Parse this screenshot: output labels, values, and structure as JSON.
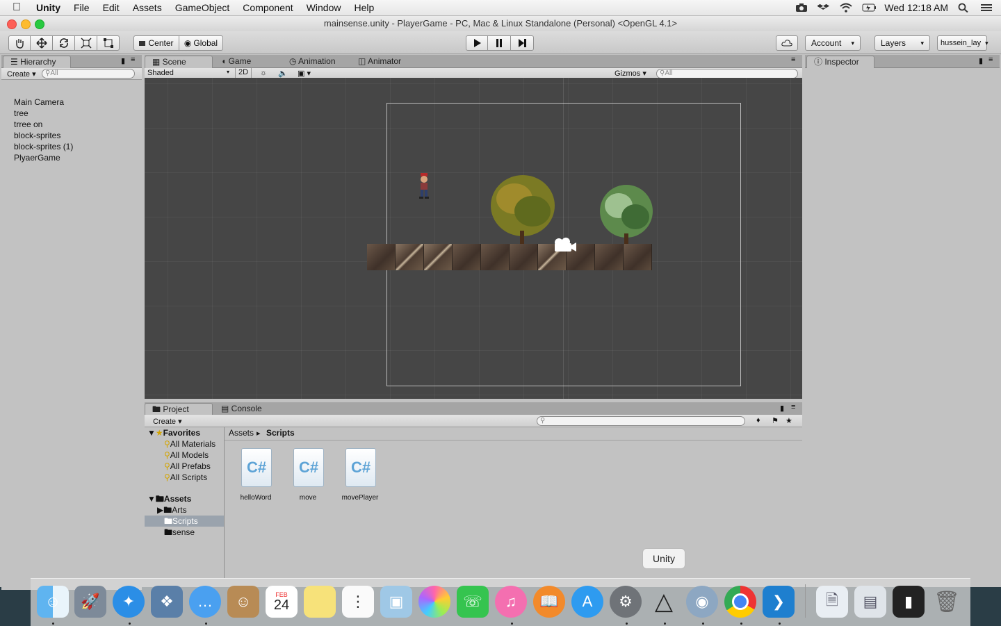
{
  "menubar": {
    "app_name": "Unity",
    "items": [
      "File",
      "Edit",
      "Assets",
      "GameObject",
      "Component",
      "Window",
      "Help"
    ],
    "clock": "Wed 12:18 AM"
  },
  "window": {
    "title": "mainsense.unity - PlayerGame - PC, Mac & Linux Standalone (Personal) <OpenGL 4.1>"
  },
  "toolbar": {
    "pivot": "Center",
    "space": "Global",
    "account": "Account",
    "layers": "Layers",
    "layout": "hussein_lay"
  },
  "hierarchy": {
    "tab": "Hierarchy",
    "create": "Create",
    "search_placeholder": "All",
    "items": [
      "Main Camera",
      "tree",
      "trree on",
      "block-sprites",
      "block-sprites (1)",
      "PlyaerGame"
    ]
  },
  "scene_panel": {
    "tabs": [
      "Scene",
      "Game",
      "Animation",
      "Animator"
    ],
    "shading": "Shaded",
    "mode_2d": "2D",
    "gizmos": "Gizmos",
    "search_placeholder": "All"
  },
  "inspector": {
    "tab": "Inspector"
  },
  "project": {
    "tabs": [
      "Project",
      "Console"
    ],
    "create": "Create",
    "favorites_label": "Favorites",
    "favorites": [
      "All Materials",
      "All Models",
      "All Prefabs",
      "All Scripts"
    ],
    "assets_label": "Assets",
    "folders": [
      "Arts",
      "Scripts",
      "sense"
    ],
    "breadcrumb": [
      "Assets",
      "Scripts"
    ],
    "scripts": [
      "helloWord",
      "move",
      "movePlayer"
    ]
  },
  "dock": {
    "tooltip": "Unity",
    "calendar_month": "FEB",
    "calendar_day": "24"
  }
}
